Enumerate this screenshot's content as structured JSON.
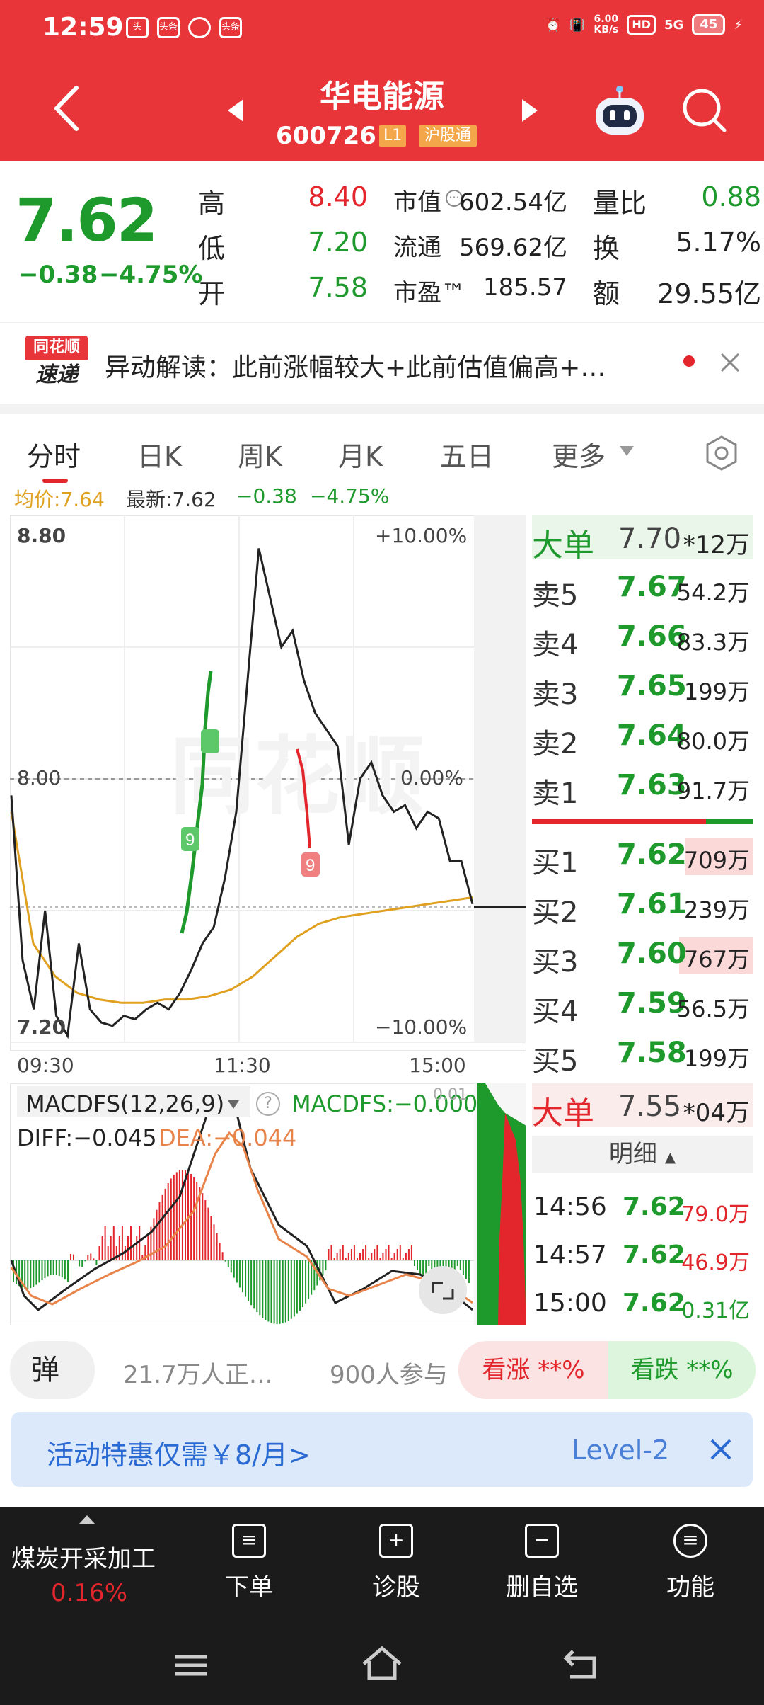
{
  "status": {
    "time": "12:59",
    "apps": [
      "头",
      "头条"
    ],
    "net_speed_top": "6.00",
    "net_speed_bot": "KB/s",
    "hd": "HD",
    "signal": "5G",
    "battery": "45"
  },
  "header": {
    "name": "华电能源",
    "code": "600726",
    "tag_level": "L1",
    "tag_connect": "沪股通"
  },
  "quote": {
    "price": "7.62",
    "change": "−0.38",
    "change_pct": "−4.75%",
    "high_label": "高",
    "high": "8.40",
    "low_label": "低",
    "low": "7.20",
    "open_label": "开",
    "open": "7.58",
    "mktcap_label": "市值",
    "mktcap": "602.54亿",
    "float_label": "流通",
    "float": "569.62亿",
    "pe_label": "市盈™",
    "pe": "185.57",
    "vr_label": "量比",
    "vr": "0.88",
    "turn_label": "换",
    "turn": "5.17%",
    "amt_label": "额",
    "amt": "29.55亿"
  },
  "news": {
    "logo_top": "同花顺",
    "logo_bottom": "速递",
    "text": "异动解读：此前涨幅较大+此前估值偏高+…"
  },
  "tabs": [
    "分时",
    "日K",
    "周K",
    "月K",
    "五日",
    "更多"
  ],
  "legend": {
    "avg_label": "均价:",
    "avg_value": "7.64",
    "latest_label": "最新:",
    "latest_value": "7.62",
    "chg": "−0.38",
    "chg_pct": "−4.75%"
  },
  "chart_labels": {
    "top_price": "8.80",
    "top_pct": "+10.00%",
    "mid_price": "8.00",
    "mid_pct": "0.00%",
    "bot_price": "7.20",
    "bot_pct": "−10.00%",
    "t_start": "09:30",
    "t_mid": "11:30",
    "t_end": "15:00",
    "marker_9": "9"
  },
  "macd": {
    "title": "MACDFS(12,26,9)",
    "value_label": "MACDFS:−0.000",
    "diff": "DIFF:−0.045",
    "dea": "DEA:−0.044",
    "corner": "0.01"
  },
  "orderbook": {
    "big_label": "大单",
    "big_price": "7.70",
    "big_vol": "*12万",
    "asks": [
      {
        "label": "卖5",
        "price": "7.67",
        "vol": "54.2万"
      },
      {
        "label": "卖4",
        "price": "7.66",
        "vol": "83.3万"
      },
      {
        "label": "卖3",
        "price": "7.65",
        "vol": "199万"
      },
      {
        "label": "卖2",
        "price": "7.64",
        "vol": "80.0万"
      },
      {
        "label": "卖1",
        "price": "7.63",
        "vol": "91.7万"
      }
    ],
    "bids": [
      {
        "label": "买1",
        "price": "7.62",
        "vol": "709万"
      },
      {
        "label": "买2",
        "price": "7.61",
        "vol": "239万"
      },
      {
        "label": "买3",
        "price": "7.60",
        "vol": "767万"
      },
      {
        "label": "买4",
        "price": "7.59",
        "vol": "56.5万"
      },
      {
        "label": "买5",
        "price": "7.58",
        "vol": "199万"
      }
    ],
    "big2_label": "大单",
    "big2_price": "7.55",
    "big2_vol": "*04万",
    "detail_label": "明细",
    "ticks": [
      {
        "time": "14:56",
        "price": "7.62",
        "vol": "79.0万"
      },
      {
        "time": "14:57",
        "price": "7.62",
        "vol": "46.9万"
      },
      {
        "time": "15:00",
        "price": "7.62",
        "vol": "0.31亿"
      }
    ]
  },
  "barrage": {
    "btn": "弹",
    "watching": "21.7万人正…",
    "joined": "900人参与",
    "up": "看涨 **%",
    "down": "看跌 **%"
  },
  "promo": {
    "text": "活动特惠仅需￥8/月>",
    "right": "Level-2"
  },
  "bottom": {
    "sector_name": "煤炭开采加工",
    "sector_pct": "0.16%",
    "items": [
      {
        "label": "下单",
        "icon": "≡"
      },
      {
        "label": "诊股",
        "icon": "+"
      },
      {
        "label": "删自选",
        "icon": "−"
      },
      {
        "label": "功能",
        "icon": "≡"
      }
    ]
  },
  "colors": {
    "red": "#e3262c",
    "green": "#1e9a2c",
    "header": "#e8353a",
    "avg_line": "#e0a020"
  },
  "chart_data": {
    "type": "line",
    "x_range": [
      "09:30",
      "15:00"
    ],
    "ylim": [
      7.2,
      8.8
    ],
    "prev_close": 8.0,
    "price_series_approx": [
      7.95,
      7.45,
      7.3,
      7.6,
      7.28,
      7.22,
      7.5,
      7.3,
      7.26,
      7.25,
      7.28,
      7.27,
      7.3,
      7.32,
      7.3,
      7.35,
      7.42,
      7.5,
      7.55,
      7.7,
      7.9,
      8.3,
      8.7,
      8.55,
      8.4,
      8.45,
      8.3,
      8.2,
      8.15,
      8.1,
      7.8,
      8.0,
      8.05,
      7.95,
      7.9,
      7.92,
      7.85,
      7.9,
      7.88,
      7.75,
      7.75,
      7.62
    ],
    "avg_series_approx": [
      7.9,
      7.5,
      7.4,
      7.35,
      7.33,
      7.32,
      7.32,
      7.33,
      7.33,
      7.34,
      7.36,
      7.4,
      7.46,
      7.52,
      7.56,
      7.58,
      7.59,
      7.6,
      7.61,
      7.62,
      7.63,
      7.64
    ]
  }
}
